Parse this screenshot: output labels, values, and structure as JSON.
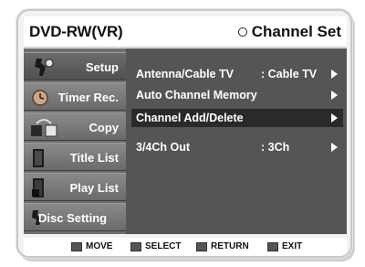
{
  "header": {
    "device": "DVD-RW(VR)",
    "section": "Channel Set"
  },
  "sidebar": {
    "items": [
      {
        "label": "Setup",
        "icon": "setup-icon",
        "active": true
      },
      {
        "label": "Timer Rec.",
        "icon": "timer-icon"
      },
      {
        "label": "Copy",
        "icon": "copy-icon"
      },
      {
        "label": "Title List",
        "icon": "title-list-icon"
      },
      {
        "label": "Play List",
        "icon": "play-list-icon"
      },
      {
        "label": "Disc Setting",
        "icon": "disc-setting-icon"
      }
    ]
  },
  "menu": {
    "rows": [
      {
        "label": "Antenna/Cable TV",
        "value": ": Cable TV"
      },
      {
        "label": "Auto Channel Memory",
        "value": ""
      },
      {
        "label": "Channel Add/Delete",
        "value": "",
        "highlighted": true
      },
      {
        "label": "3/4Ch Out",
        "value": ": 3Ch"
      }
    ]
  },
  "footer": {
    "move": "MOVE",
    "select": "SELECT",
    "return": "RETURN",
    "exit": "EXIT"
  }
}
